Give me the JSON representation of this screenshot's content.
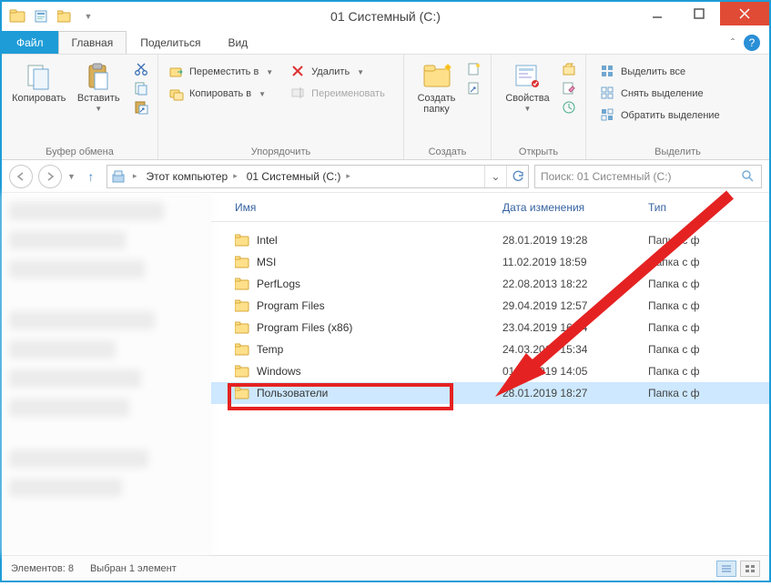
{
  "title": "01 Системный (C:)",
  "menu": {
    "file": "Файл",
    "home": "Главная",
    "share": "Поделиться",
    "view": "Вид"
  },
  "ribbon": {
    "clipboard": {
      "label": "Буфер обмена",
      "copy": "Копировать",
      "paste": "Вставить"
    },
    "organize": {
      "label": "Упорядочить",
      "moveto": "Переместить в",
      "copyto": "Копировать в",
      "delete": "Удалить",
      "rename": "Переименовать"
    },
    "new": {
      "label": "Создать",
      "newfolder": "Создать\nпапку"
    },
    "open": {
      "label": "Открыть",
      "properties": "Свойства"
    },
    "select": {
      "label": "Выделить",
      "selectall": "Выделить все",
      "selectnone": "Снять выделение",
      "invert": "Обратить выделение"
    }
  },
  "breadcrumb": {
    "thispc": "Этот компьютер",
    "drive": "01 Системный (C:)"
  },
  "search": {
    "placeholder": "Поиск: 01 Системный (C:)"
  },
  "columns": {
    "name": "Имя",
    "date": "Дата изменения",
    "type": "Тип"
  },
  "items": [
    {
      "name": "Intel",
      "date": "28.01.2019 19:28",
      "type": "Папка с ф"
    },
    {
      "name": "MSI",
      "date": "11.02.2019 18:59",
      "type": "Папка с ф"
    },
    {
      "name": "PerfLogs",
      "date": "22.08.2013 18:22",
      "type": "Папка с ф"
    },
    {
      "name": "Program Files",
      "date": "29.04.2019 12:57",
      "type": "Папка с ф"
    },
    {
      "name": "Program Files (x86)",
      "date": "23.04.2019 16:04",
      "type": "Папка с ф"
    },
    {
      "name": "Temp",
      "date": "24.03.2019 15:34",
      "type": "Папка с ф"
    },
    {
      "name": "Windows",
      "date": "01.05.2019 14:05",
      "type": "Папка с ф"
    },
    {
      "name": "Пользователи",
      "date": "28.01.2019 18:27",
      "type": "Папка с ф",
      "selected": true,
      "highlighted": true
    }
  ],
  "status": {
    "count": "Элементов: 8",
    "selected": "Выбран 1 элемент"
  }
}
